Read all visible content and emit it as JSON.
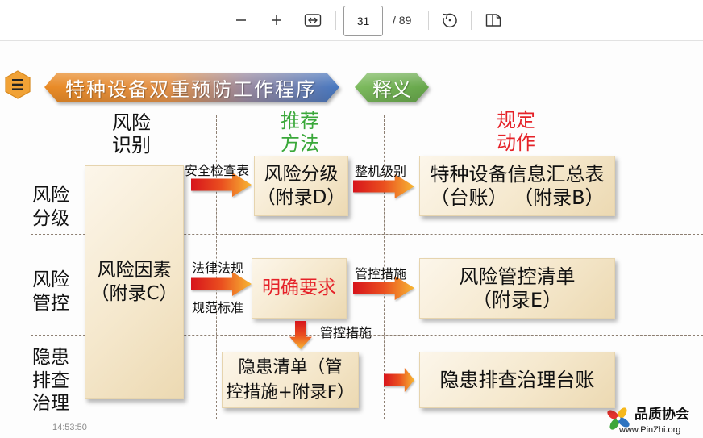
{
  "viewer": {
    "toolbar": {
      "icons": {
        "zoom_out": "minus-icon",
        "zoom_in": "plus-icon",
        "fit_width": "fit-width-icon",
        "rotate": "rotate-icon",
        "page_view": "page-view-icon"
      },
      "page_current": "31",
      "page_total": "/ 89"
    }
  },
  "slide": {
    "menu_icon": "menu-icon",
    "title": "特种设备双重预防工作程序",
    "badge": "释义",
    "column_headers": {
      "identify": "风险\n识别",
      "method": "推荐\n方法",
      "action": "规定\n动作"
    },
    "row_labels": {
      "grading": "风险\n分级",
      "control": "风险\n管控",
      "hazard": "隐患\n排查\n治理"
    },
    "boxes": {
      "risk_factors": "风险因素\n（附录C）",
      "risk_grading": "风险分级\n（附录D）",
      "equipment_ledger": "特种设备信息汇总表\n（台账） （附录B）",
      "clear_requirements": "明确要求",
      "risk_control_list": "风险管控清单\n（附录E）",
      "hazard_list": "隐患清单（管\n控措施+附录F）",
      "hazard_ledger": "隐患排查治理台账"
    },
    "arrow_labels": {
      "safety_checklist": "安全检查表",
      "machine_level": "整机级别",
      "laws": "法律法规",
      "standards": "规范标准",
      "control_measures": "管控措施",
      "control_measures_down": "管控措施"
    },
    "timestamp": "14:53:50",
    "colors": {
      "title_start": "#e98a24",
      "title_end": "#4677c0",
      "badge": "#66a64a",
      "method_header": "#3aa83a",
      "action_header": "#e52229",
      "emphasis": "#e52229",
      "arrow_start": "#d7141c",
      "arrow_end": "#f7b733"
    }
  },
  "watermark": {
    "name": "品质协会",
    "url": "www.PinZhi.org"
  }
}
